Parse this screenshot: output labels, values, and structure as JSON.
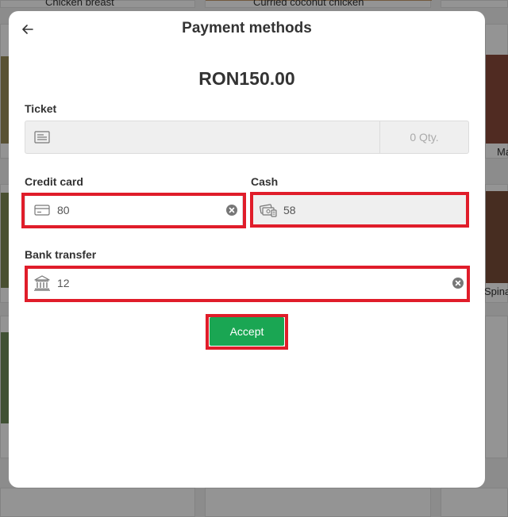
{
  "background": {
    "tiles": [
      {
        "name": "Chicken breast"
      },
      {
        "name": "Curried coconut chicken"
      },
      {
        "name": "Ma"
      },
      {
        "name": "Spinac"
      }
    ]
  },
  "modal": {
    "title": "Payment methods",
    "back_icon": "arrow-left-icon",
    "amount": "RON150.00",
    "ticket": {
      "label": "Ticket",
      "value": "",
      "qty_placeholder": "0 Qty.",
      "icon": "ticket-icon"
    },
    "credit_card": {
      "label": "Credit card",
      "value": "80",
      "icon": "credit-card-icon"
    },
    "cash": {
      "label": "Cash",
      "value": "58",
      "icon": "cash-icon"
    },
    "bank_transfer": {
      "label": "Bank transfer",
      "value": "12",
      "icon": "bank-icon"
    },
    "accept_label": "Accept"
  },
  "colors": {
    "accent_green": "#1aa653",
    "highlight_red": "#e01d2a"
  }
}
